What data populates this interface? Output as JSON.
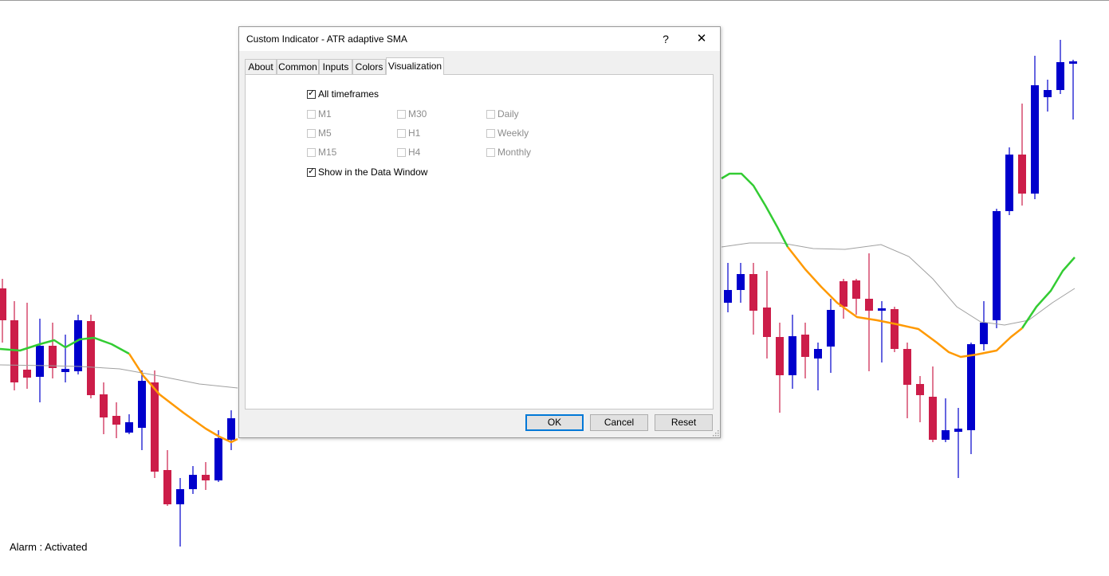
{
  "status_text": "Alarm : Activated",
  "colors": {
    "bull_candle": "#0000cc",
    "bear_candle": "#cc1d49",
    "sma_up": "#33cc33",
    "sma_down": "#ff9900",
    "avg_line": "#a0a0a0"
  },
  "dialog": {
    "title": "Custom Indicator - ATR adaptive SMA",
    "help_label": "?",
    "close_label": "✕",
    "tabs": [
      "About",
      "Common",
      "Inputs",
      "Colors",
      "Visualization"
    ],
    "active_tab": "Visualization",
    "all_timeframes": {
      "label": "All timeframes",
      "checked": true
    },
    "timeframes": [
      {
        "label": "M1",
        "checked": false
      },
      {
        "label": "M5",
        "checked": false
      },
      {
        "label": "M15",
        "checked": false
      },
      {
        "label": "M30",
        "checked": false
      },
      {
        "label": "H1",
        "checked": false
      },
      {
        "label": "H4",
        "checked": false
      },
      {
        "label": "Daily",
        "checked": false
      },
      {
        "label": "Weekly",
        "checked": false
      },
      {
        "label": "Monthly",
        "checked": false
      }
    ],
    "show_data_window": {
      "label": "Show in the Data Window",
      "checked": true
    },
    "buttons": {
      "ok": "OK",
      "cancel": "Cancel",
      "reset": "Reset"
    }
  }
}
